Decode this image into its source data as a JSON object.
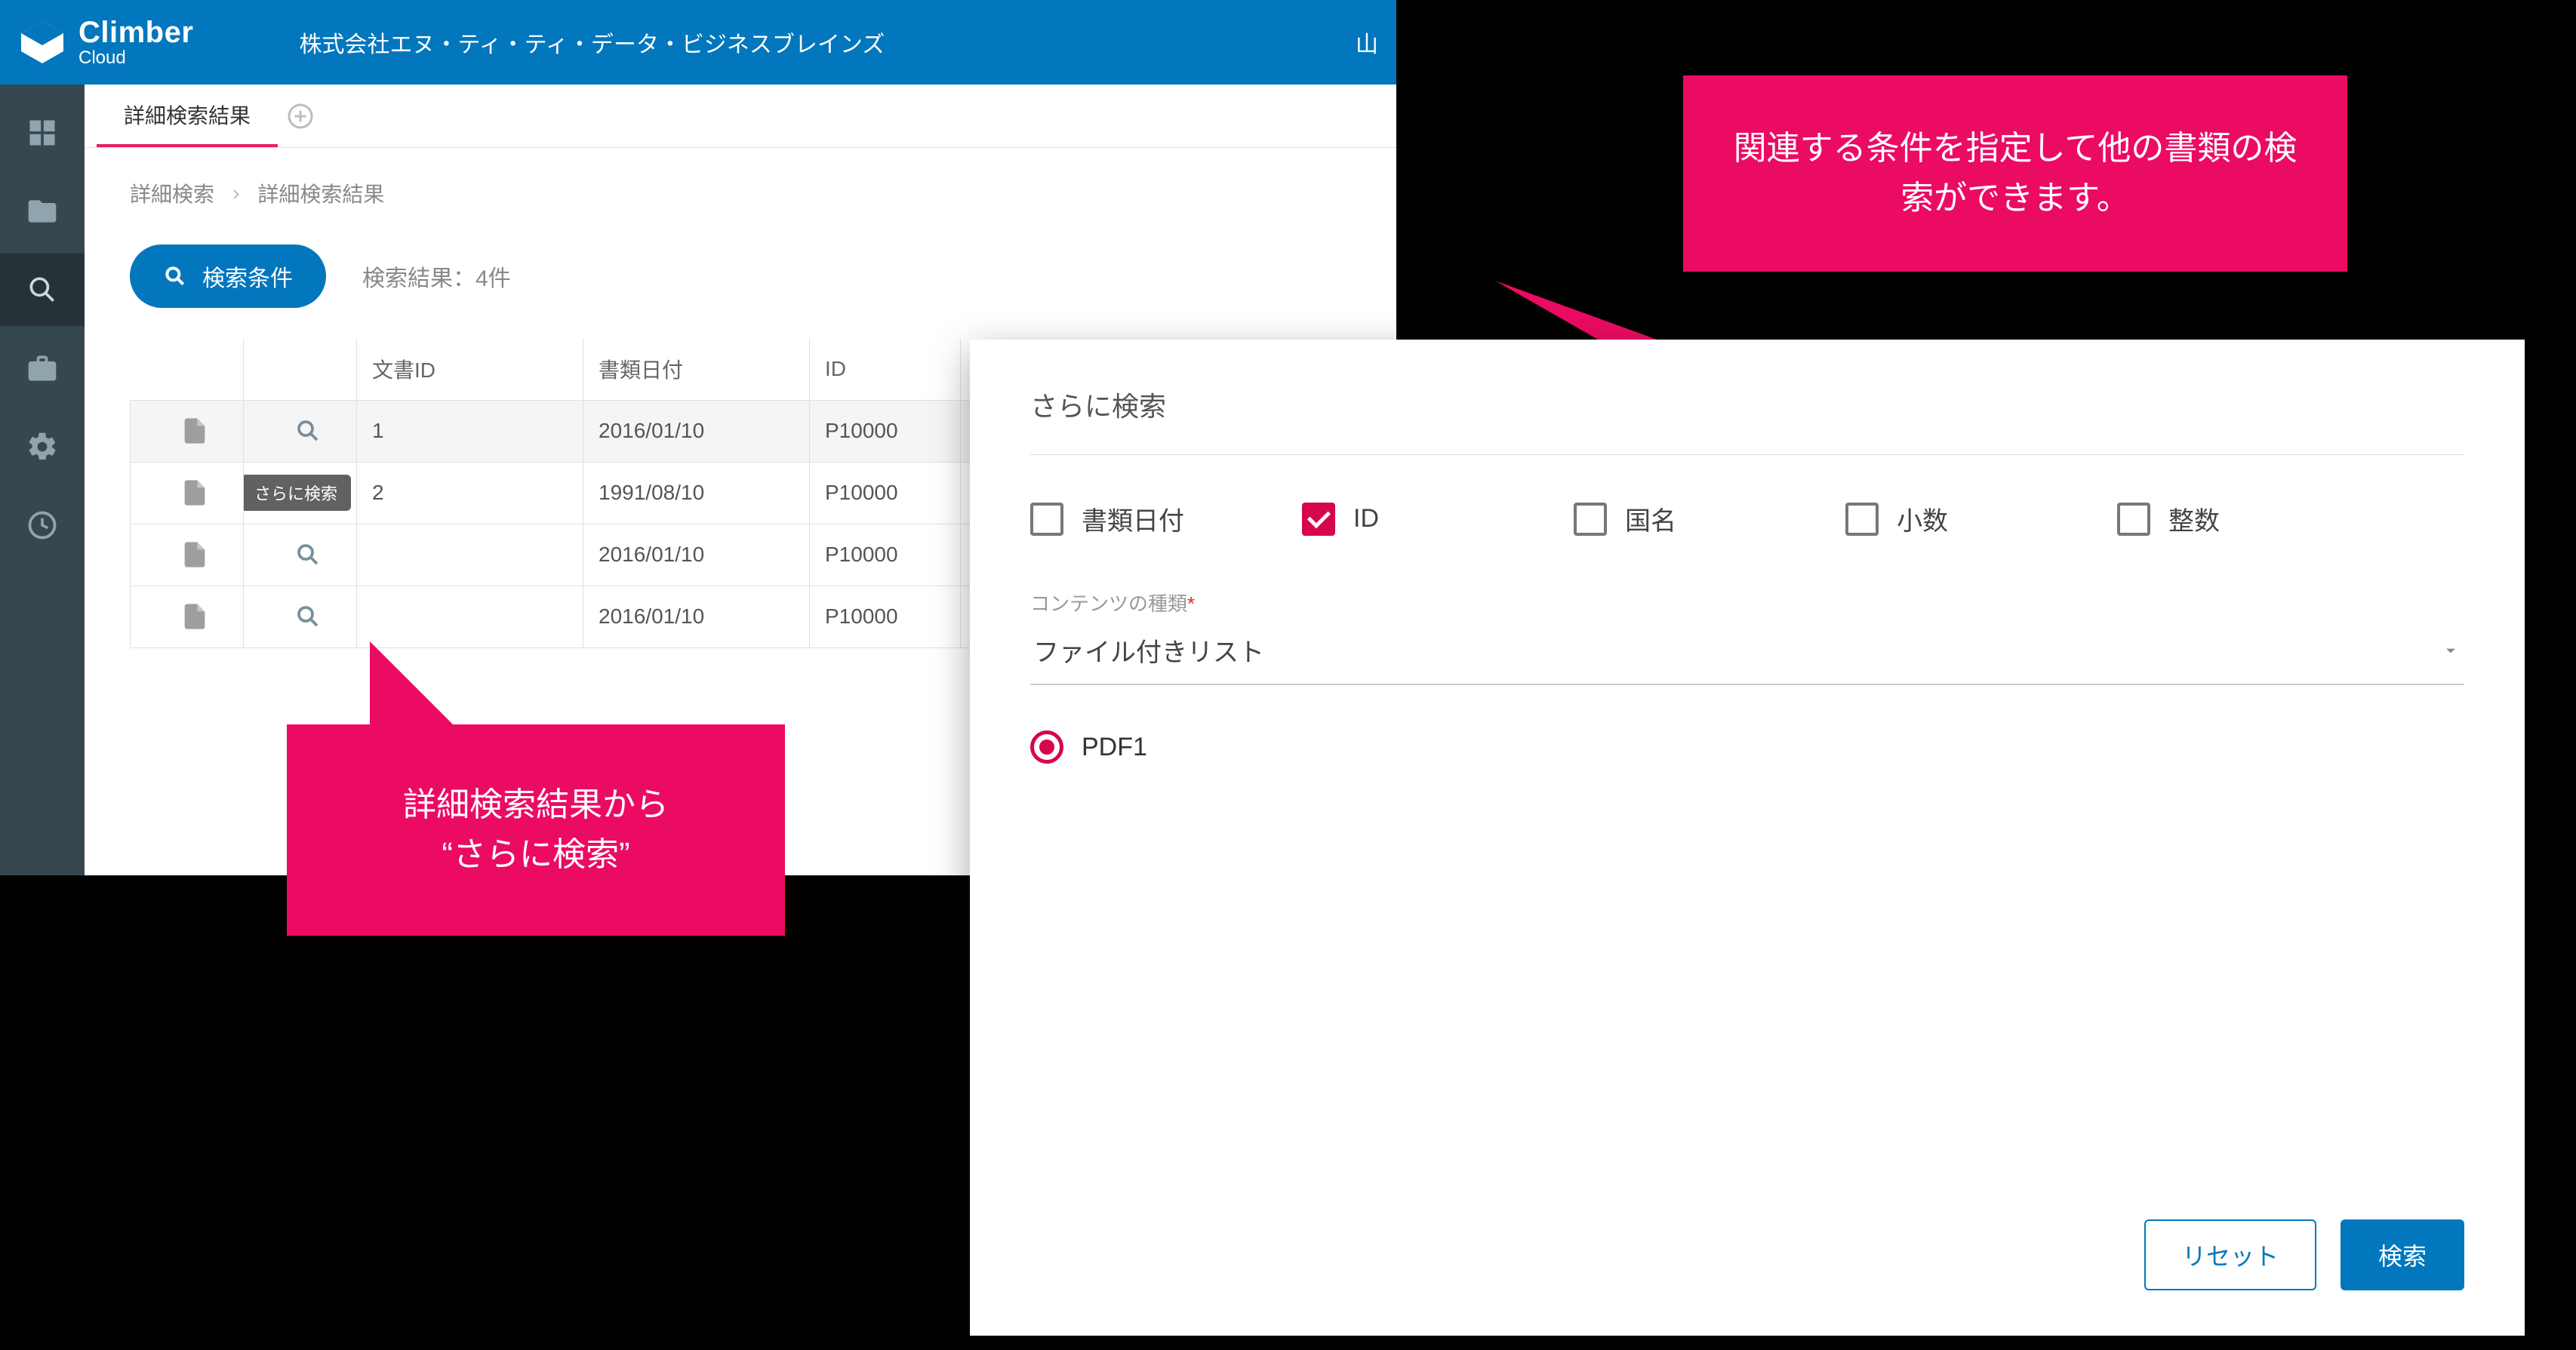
{
  "brand": {
    "name": "Climber",
    "sub": "Cloud"
  },
  "company": "株式会社エヌ・ティ・ティ・データ・ビジネスブレインズ",
  "user_initial": "山",
  "tab": {
    "active": "詳細検索結果"
  },
  "breadcrumb": {
    "a": "詳細検索",
    "b": "詳細検索結果"
  },
  "search_button": "検索条件",
  "result_count": "検索結果：4件",
  "tooltip": "さらに検索",
  "columns": {
    "doc_id": "文書ID",
    "doc_date": "書類日付",
    "id": "ID"
  },
  "rows": [
    {
      "doc_id": "1",
      "doc_date": "2016/01/10",
      "id": "P10000"
    },
    {
      "doc_id": "2",
      "doc_date": "1991/08/10",
      "id": "P10000"
    },
    {
      "doc_id": "",
      "doc_date": "2016/01/10",
      "id": "P10000"
    },
    {
      "doc_id": "",
      "doc_date": "2016/01/10",
      "id": "P10000"
    }
  ],
  "callout_left": "詳細検索結果から\n“さらに検索”",
  "callout_right": "関連する条件を指定して他の書類の検索ができます。",
  "dialog": {
    "title": "さらに検索",
    "checks": [
      {
        "label": "書類日付",
        "checked": false
      },
      {
        "label": "ID",
        "checked": true
      },
      {
        "label": "国名",
        "checked": false
      },
      {
        "label": "小数",
        "checked": false
      },
      {
        "label": "整数",
        "checked": false
      }
    ],
    "content_type_label": "コンテンツの種類",
    "content_type_value": "ファイル付きリスト",
    "radio_value": "PDF1",
    "reset": "リセット",
    "search": "検索"
  }
}
